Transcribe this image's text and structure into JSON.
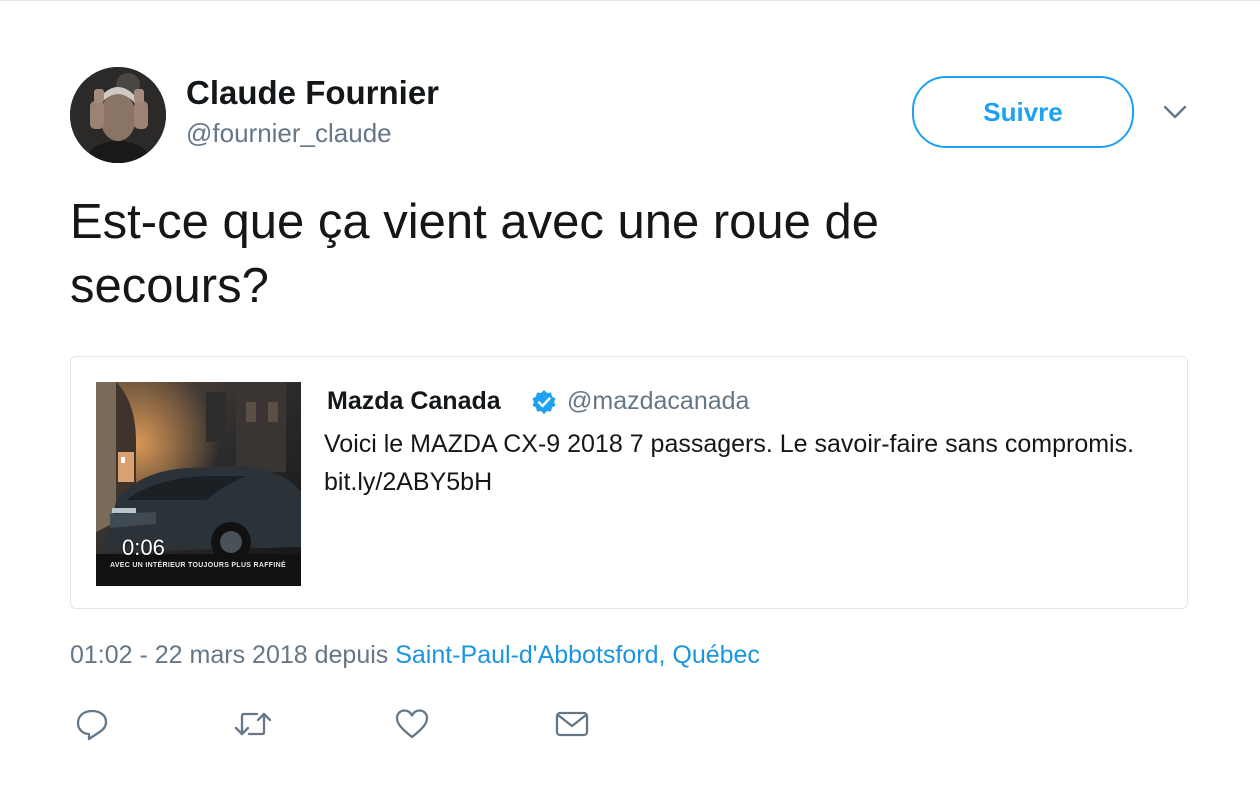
{
  "author": {
    "display_name": "Claude Fournier",
    "handle": "@fournier_claude"
  },
  "follow_button_label": "Suivre",
  "tweet": {
    "text": "Est-ce que ça vient avec une roue de secours?"
  },
  "quoted_tweet": {
    "display_name": "Mazda Canada",
    "verified": true,
    "handle": "@mazdacanada",
    "text": "Voici le MAZDA CX-9 2018 7 passagers. Le savoir-faire sans compromis. bit.ly/2ABY5bH",
    "media": {
      "duration": "0:06",
      "caption": "AVEC UN INTÉRIEUR TOUJOURS PLUS RAFFINÉ"
    }
  },
  "meta": {
    "time": "01:02",
    "separator": " - ",
    "date": "22 mars 2018",
    "source_prefix": " depuis ",
    "location": "Saint-Paul-d'Abbotsford, Québec"
  },
  "actions": [
    {
      "name": "reply",
      "icon": "reply-icon"
    },
    {
      "name": "retweet",
      "icon": "retweet-icon"
    },
    {
      "name": "like",
      "icon": "heart-icon"
    },
    {
      "name": "direct-message",
      "icon": "envelope-icon"
    }
  ],
  "colors": {
    "accent": "#1da1f2",
    "link": "#1b95e0",
    "secondary_text": "#657786",
    "primary_text": "#14171a",
    "border": "#e1e8ed"
  }
}
